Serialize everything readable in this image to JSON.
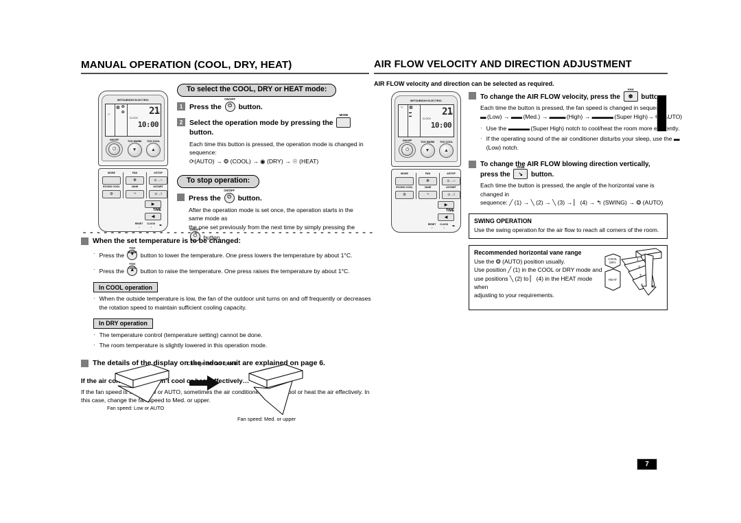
{
  "left": {
    "title": "MANUAL OPERATION (COOL, DRY, HEAT)",
    "pill_select": "To select the COOL, DRY or HEAT mode:",
    "step1": {
      "num": "1",
      "pre": "Press the",
      "chip_cap": "ON/OFF",
      "chip_glyph": "⏻",
      "post": "button."
    },
    "step2": {
      "num": "2",
      "pre": "Select the operation mode by pressing the",
      "chip_cap": "MODE",
      "post": "button.",
      "detail_line1": "Each time this button is pressed, the operation mode is changed in sequence:",
      "detail_line2": "(AUTO) →      (COOL) →      (DRY) →      (HEAT)",
      "seq": [
        {
          "icon": "auto-mode-icon",
          "glyph": "↻",
          "label": "(AUTO)"
        },
        {
          "icon": "cool-mode-icon",
          "glyph": "❄",
          "label": "(COOL)"
        },
        {
          "icon": "dry-mode-icon",
          "glyph": "○",
          "label": "(DRY)"
        },
        {
          "icon": "heat-mode-icon",
          "glyph": "☀",
          "label": "(HEAT)"
        }
      ]
    },
    "pill_stop": "To stop operation:",
    "stop_step": {
      "pre": "Press the",
      "chip_cap": "ON/OFF",
      "chip_glyph": "⏻",
      "post": "button."
    },
    "stop_detail_1": "After the operation mode is set once, the operation starts in the same mode as",
    "stop_detail_2a": "the one set previously from the next time by simply pressing the",
    "stop_detail_2b": "button.",
    "temp_heading": "When the set temperature is to be changed:",
    "temp_bullets": [
      {
        "pre": "Press the",
        "chip_cap": "TOO WARM",
        "chip_glyph": "▼",
        "post": "button to lower the temperature. One press lowers the temperature by about 1°C."
      },
      {
        "pre": "Press the",
        "chip_cap": "TOO COOL",
        "chip_glyph": "▲",
        "post": "button to raise the temperature. One press raises the temperature by about 1°C."
      }
    ],
    "cool_label": "In COOL operation",
    "cool_bullet": "When the outside temperature is low, the fan of the outdoor unit turns on and off frequently or decreases the rotation speed to maintain sufficient cooling capacity.",
    "dry_label": "In DRY operation",
    "dry_bullets": [
      "The temperature control (temperature setting) cannot be done.",
      "The room temperature is slightly lowered in this operation mode."
    ],
    "details_note": "The details of the display on the indoor unit are explained on page 6.",
    "ineffective_heading": "If the air conditioner doesn’t cool or heat effectively…",
    "ineffective_body": "If the fan speed is set to Low or AUTO, sometimes the air conditioner may not cool or heat the air effectively. In this case, change the fan speed to Med. or upper.",
    "figure": {
      "change_caption": "Change the fan speed.",
      "left_caption": "Fan speed: Low or AUTO",
      "right_caption": "Fan speed: Med. or upper"
    }
  },
  "right": {
    "title": "AIR FLOW VELOCITY AND DIRECTION ADJUSTMENT",
    "intro": "AIR FLOW velocity and direction can be selected as required.",
    "velocity": {
      "pre": "To change the AIR FLOW velocity, press the",
      "chip_cap": "FAN",
      "chip_glyph": "❆",
      "post": "button.",
      "detail": "Each time the button is pressed, the fan speed is changed in sequence:",
      "seq": [
        {
          "icon": "fan-low-icon",
          "bars": 1,
          "label": "(Low)"
        },
        {
          "icon": "fan-med-icon",
          "bars": 2,
          "label": "(Med.)"
        },
        {
          "icon": "fan-high-icon",
          "bars": 3,
          "label": "(High)"
        },
        {
          "icon": "fan-super-high-icon",
          "bars": 4,
          "label": "(Super High)"
        },
        {
          "icon": "fan-auto-icon",
          "bars": 0,
          "glyph": "❂",
          "label": "(AUTO)"
        }
      ],
      "bullets": [
        {
          "pre": "Use the",
          "icon": "fan-super-high-icon",
          "bars": 4,
          "post": "(Super High) notch to cool/heat the room more efficiently."
        },
        {
          "pre": "If the operating sound of the air conditioner disturbs your sleep, use the",
          "icon": "fan-low-icon",
          "bars": 1,
          "post": "(Low) notch."
        }
      ]
    },
    "direction": {
      "pre": "To change the AIR FLOW blowing direction vertically, press the",
      "chip_cap": "VANE",
      "chip_glyph": "↘",
      "post": "button.",
      "detail_1": "Each time the button is pressed, the angle of the horizontal vane is changed in",
      "detail_2": "sequence:",
      "seq": [
        {
          "icon": "vane-position-1-icon",
          "angle": -20,
          "label": "(1)"
        },
        {
          "icon": "vane-position-2-icon",
          "angle": -45,
          "label": "(2)"
        },
        {
          "icon": "vane-position-3-icon",
          "angle": -65,
          "label": "(3)"
        },
        {
          "icon": "vane-position-4-icon",
          "angle": -85,
          "label": "(4)"
        },
        {
          "icon": "vane-swing-icon",
          "glyph": "↪",
          "label": "(SWING)"
        },
        {
          "icon": "vane-auto-icon",
          "glyph": "❂",
          "label": "(AUTO)"
        }
      ]
    },
    "swing_box": {
      "title": "SWING OPERATION",
      "body": "Use the swing operation for the air flow to reach all corners of the room."
    },
    "vane_box": {
      "title": "Recommended horizontal vane range",
      "line1a": "Use the",
      "line1b": "(AUTO) position usually.",
      "line2a": "Use position",
      "line2b": "(1) in the COOL or DRY mode and",
      "line3a": "use positions",
      "line3b": "(2) to",
      "line3c": "(4) in the HEAT mode when",
      "line4": "adjusting to your requirements.",
      "diagram": {
        "cool_dry_label_1": "COOL",
        "cool_dry_label_2": "DRY",
        "heat_label": "HEAT",
        "positions": [
          "1",
          "2",
          "3",
          "4"
        ]
      }
    }
  },
  "remote": {
    "brand": "MITSUBISHI ELECTRIC",
    "lcd": {
      "temp": "21",
      "temp_unit": "°C",
      "clock_label": "CLOCK",
      "clock": "10:00"
    },
    "labels": {
      "onoff": "ON/OFF",
      "too_warm": "TOO WARM",
      "too_cool": "TOO COOL",
      "mode": "MODE",
      "fan": "FAN",
      "stop": "⊙STOP",
      "econo_cool": "ECONO COOL",
      "vane": "VANE",
      "start": "⊙START",
      "time": "TIME",
      "reset": "RESET",
      "clock": "CLOCK",
      "stop_key": "⊙→○",
      "start_key": "⊙→I"
    }
  },
  "page_number": "7"
}
